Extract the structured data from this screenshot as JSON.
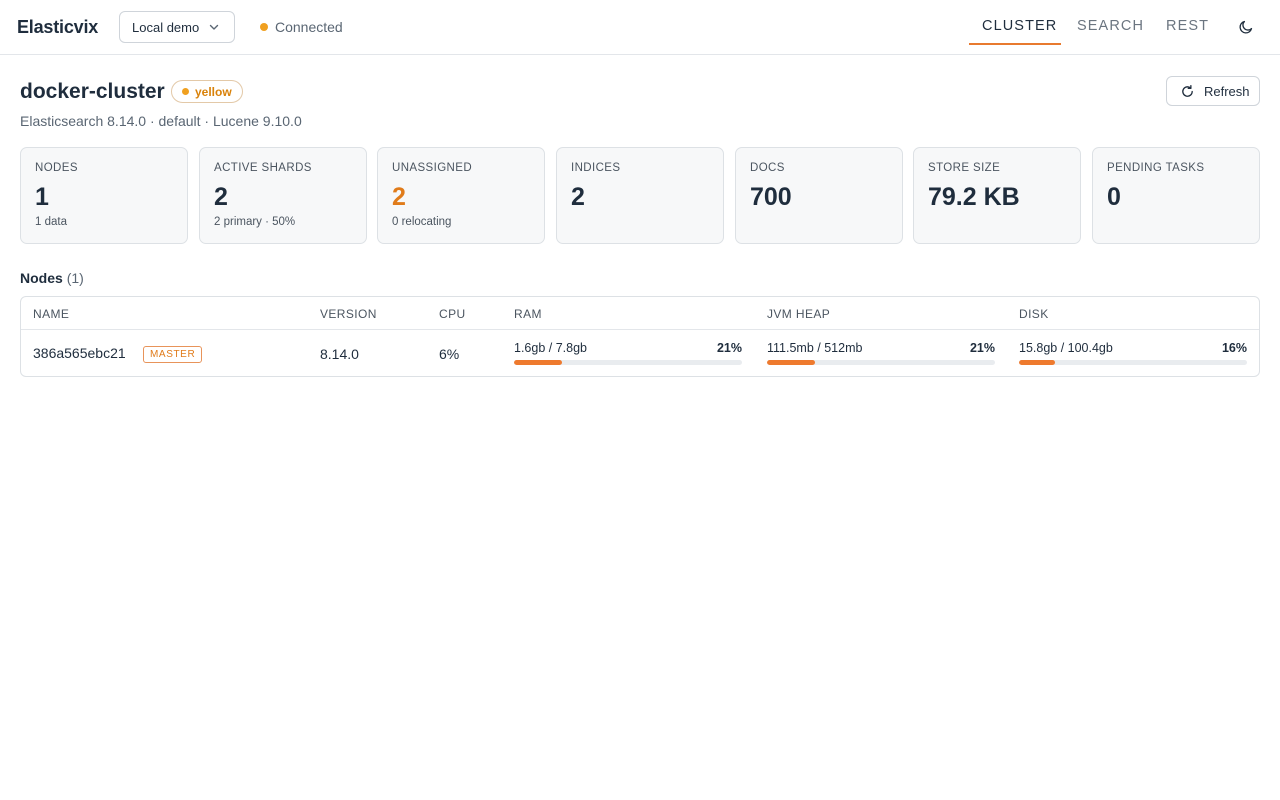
{
  "app": {
    "brand": "Elasticvix",
    "connection_select": "Local demo",
    "connection_status": "Connected"
  },
  "nav": {
    "tabs": [
      {
        "label": "CLUSTER",
        "active": true
      },
      {
        "label": "SEARCH",
        "active": false
      },
      {
        "label": "REST",
        "active": false
      }
    ],
    "theme_toggle_icon": "moon-icon"
  },
  "cluster": {
    "name": "docker-cluster",
    "health": "yellow",
    "subtitle": "Elasticsearch 8.14.0 · default · Lucene 9.10.0",
    "refresh_label": "Refresh"
  },
  "stats": [
    {
      "label": "NODES",
      "value": "1",
      "sub": "1 data",
      "warn": false
    },
    {
      "label": "ACTIVE SHARDS",
      "value": "2",
      "sub": "2 primary · 50%",
      "warn": false
    },
    {
      "label": "UNASSIGNED",
      "value": "2",
      "sub": "0 relocating",
      "warn": true
    },
    {
      "label": "INDICES",
      "value": "2",
      "sub": "",
      "warn": false
    },
    {
      "label": "DOCS",
      "value": "700",
      "sub": "",
      "warn": false
    },
    {
      "label": "STORE SIZE",
      "value": "79.2 KB",
      "sub": "",
      "warn": false
    },
    {
      "label": "PENDING TASKS",
      "value": "0",
      "sub": "",
      "warn": false
    }
  ],
  "nodes": {
    "title": "Nodes",
    "count": "(1)",
    "columns": [
      "NAME",
      "VERSION",
      "CPU",
      "RAM",
      "JVM HEAP",
      "DISK"
    ],
    "rows": [
      {
        "name": "386a565ebc21",
        "role_badge": "MASTER",
        "version": "8.14.0",
        "cpu": "6%",
        "ram": {
          "text": "1.6gb / 7.8gb",
          "pct": "21%",
          "fraction": 0.21
        },
        "heap": {
          "text": "111.5mb / 512mb",
          "pct": "21%",
          "fraction": 0.21
        },
        "disk": {
          "text": "15.8gb / 100.4gb",
          "pct": "16%",
          "fraction": 0.16
        }
      }
    ]
  },
  "colors": {
    "accent": "#e87a2f",
    "warning": "#f0a020"
  }
}
